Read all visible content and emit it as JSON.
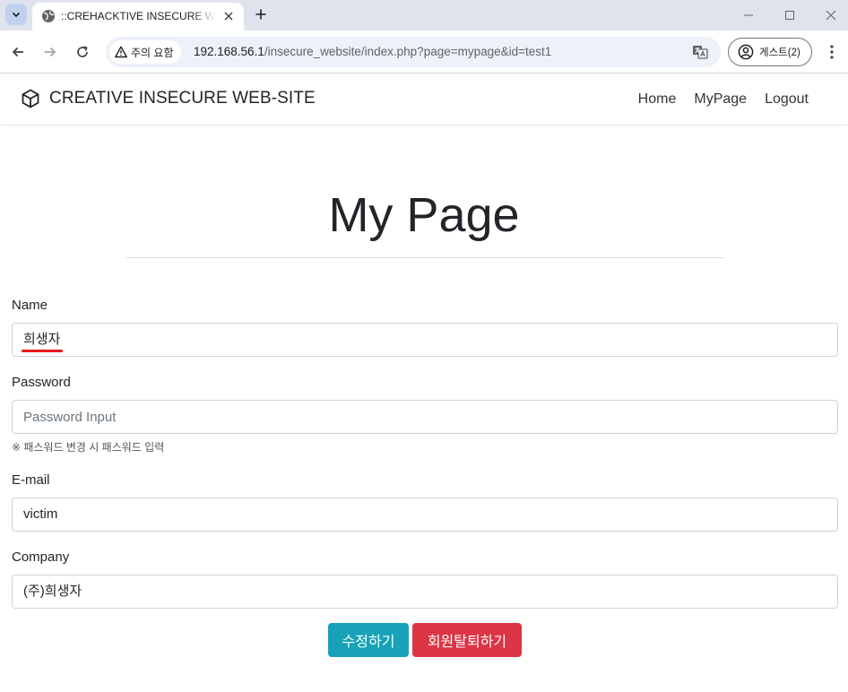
{
  "browser": {
    "tab_title": "::CREHACKTIVE INSECURE WEBSITE",
    "security_label": "주의 요함",
    "url_host": "192.168.56.1",
    "url_path": "/insecure_website/index.php?page=mypage&id=test1",
    "profile_label": "게스트(2)",
    "icons": [
      "tab-list-icon",
      "globe-icon",
      "close-icon",
      "plus-icon",
      "minimize-icon",
      "maximize-icon",
      "window-close-icon",
      "back-arrow-icon",
      "forward-arrow-icon",
      "reload-icon",
      "warning-icon",
      "translate-icon",
      "profile-icon",
      "kebab-menu-icon"
    ]
  },
  "navbar": {
    "brand": "CREATIVE INSECURE WEB-SITE",
    "brand_icon": "cube-icon",
    "links": [
      "Home",
      "MyPage",
      "Logout"
    ]
  },
  "page": {
    "title": "My Page"
  },
  "form": {
    "name_label": "Name",
    "name_value": "희생자",
    "password_label": "Password",
    "password_placeholder": "Password Input",
    "password_help": "※ 패스워드 변경 시 패스워드 입력",
    "email_label": "E-mail",
    "email_value": "victim",
    "company_label": "Company",
    "company_value": "(주)희생자",
    "edit_button": "수정하기",
    "withdraw_button": "회원탈퇴하기"
  },
  "colors": {
    "edit_button": "#17a2b8",
    "withdraw_button": "#dc3545",
    "annotation_underline": "#e8191d"
  }
}
